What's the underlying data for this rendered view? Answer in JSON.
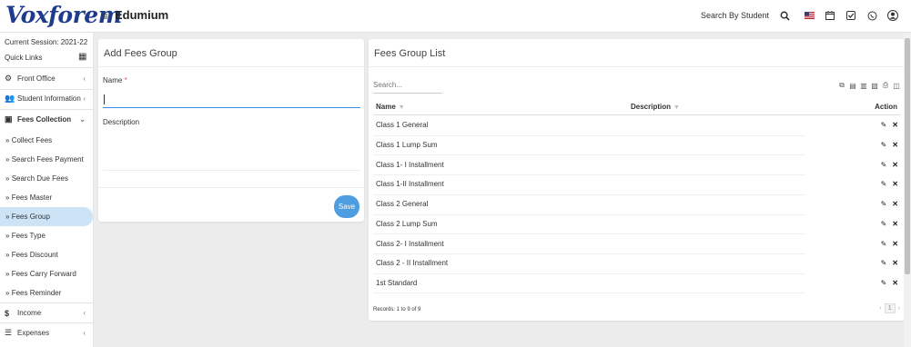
{
  "app": {
    "logo": "Voxforem",
    "name": "Edumium"
  },
  "topbar": {
    "search_label": "Search By Student Name",
    "icons": [
      "search-icon",
      "flag-icon",
      "calendar-icon",
      "check-square-icon",
      "whatsapp-icon",
      "user-avatar-icon"
    ]
  },
  "sidebar": {
    "session": "Current Session: 2021-22",
    "quick_links": "Quick Links",
    "items": [
      {
        "label": "Front Office",
        "icon": "front-office-icon",
        "arrow": "‹"
      },
      {
        "label": "Student Information",
        "icon": "student-icon",
        "arrow": "‹"
      },
      {
        "label": "Fees Collection",
        "icon": "fees-icon",
        "arrow": "⌄"
      },
      {
        "label": "Collect Fees"
      },
      {
        "label": "Search Fees Payment"
      },
      {
        "label": "Search Due Fees"
      },
      {
        "label": "Fees Master"
      },
      {
        "label": "Fees Group"
      },
      {
        "label": "Fees Type"
      },
      {
        "label": "Fees Discount"
      },
      {
        "label": "Fees Carry Forward"
      },
      {
        "label": "Fees Reminder"
      },
      {
        "label": "Income",
        "icon": "income-icon",
        "arrow": "‹"
      },
      {
        "label": "Expenses",
        "icon": "expenses-icon",
        "arrow": "‹"
      }
    ],
    "sub_prefix": "»"
  },
  "add_form": {
    "title": "Add Fees Group",
    "name_label": "Name",
    "required_mark": "*",
    "name_value": "",
    "description_label": "Description",
    "save_label": "Save"
  },
  "list": {
    "title": "Fees Group List",
    "search_placeholder": "Search...",
    "columns": {
      "name": "Name",
      "description": "Description",
      "action": "Action"
    },
    "rows": [
      {
        "name": "Class 1 General",
        "description": ""
      },
      {
        "name": "Class 1 Lump Sum",
        "description": ""
      },
      {
        "name": "Class 1- I Installment",
        "description": ""
      },
      {
        "name": "Class 1-II Installment",
        "description": ""
      },
      {
        "name": "Class 2 General",
        "description": ""
      },
      {
        "name": "Class 2 Lump Sum",
        "description": ""
      },
      {
        "name": "Class 2- I Installment",
        "description": ""
      },
      {
        "name": "Class 2 - II Installment",
        "description": ""
      },
      {
        "name": "1st Standard",
        "description": ""
      }
    ],
    "records": "Records: 1 to 9 of 9",
    "current_page": "1",
    "prev": "‹",
    "next": "›"
  },
  "colors": {
    "brand": "#1f3b8c",
    "accent": "#4d9de0",
    "active_menu": "#cde4f7"
  }
}
